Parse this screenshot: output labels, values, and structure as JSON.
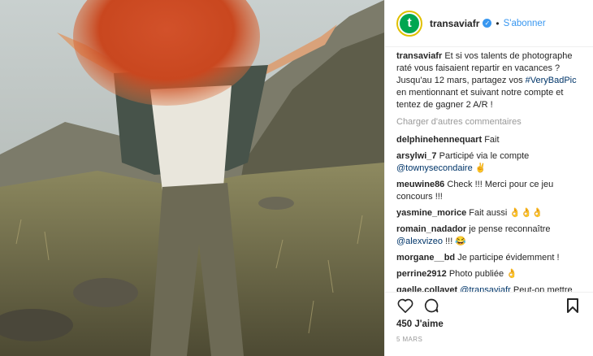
{
  "post": {
    "username": "transaviafr",
    "avatar_letter": "t",
    "separator": "•",
    "follow_label": "S'abonner",
    "caption": "Et si vos talents de photographe raté vous faisaient repartir en vacances ? Jusqu'au 12 mars, partagez vos ",
    "caption_tag": "#VeryBadPic",
    "caption_end": " en mentionnant et suivant notre compte et tentez de gagner 2 A/R !",
    "load_more": "Charger d'autres commentaires",
    "likes": "450 J'aime",
    "date": "5 MARS"
  },
  "comments": [
    {
      "user": "delphinehennequart",
      "text": "Fait"
    },
    {
      "user": "arsylwi_7",
      "text": "Participé via le compte ",
      "mention": "@townysecondaire",
      "after": " ✌"
    },
    {
      "user": "meuwine86",
      "text": "Check !!! Merci pour ce jeu concours !!!"
    },
    {
      "user": "yasmine_morice",
      "text": "Fait aussi 👌👌👌"
    },
    {
      "user": "romain_nadador",
      "text": "je pense reconnaître ",
      "mention": "@alexvizeo",
      "after": " !!! 😂"
    },
    {
      "user": "morgane__bd",
      "text": "Je participe évidemment !"
    },
    {
      "user": "perrine2912",
      "text": "Photo publiée 👌"
    },
    {
      "user": "gaelle.collavet",
      "text": "",
      "mention": "@transaviafr",
      "after": " Peut-on mettre sous notre photo plusieurs hastag"
    }
  ],
  "colors": {
    "accent": "#3897f0",
    "brand": "#00a651",
    "muted": "#999999"
  },
  "icons": [
    "heart-icon",
    "comment-icon",
    "bookmark-icon",
    "verified-badge-icon"
  ]
}
